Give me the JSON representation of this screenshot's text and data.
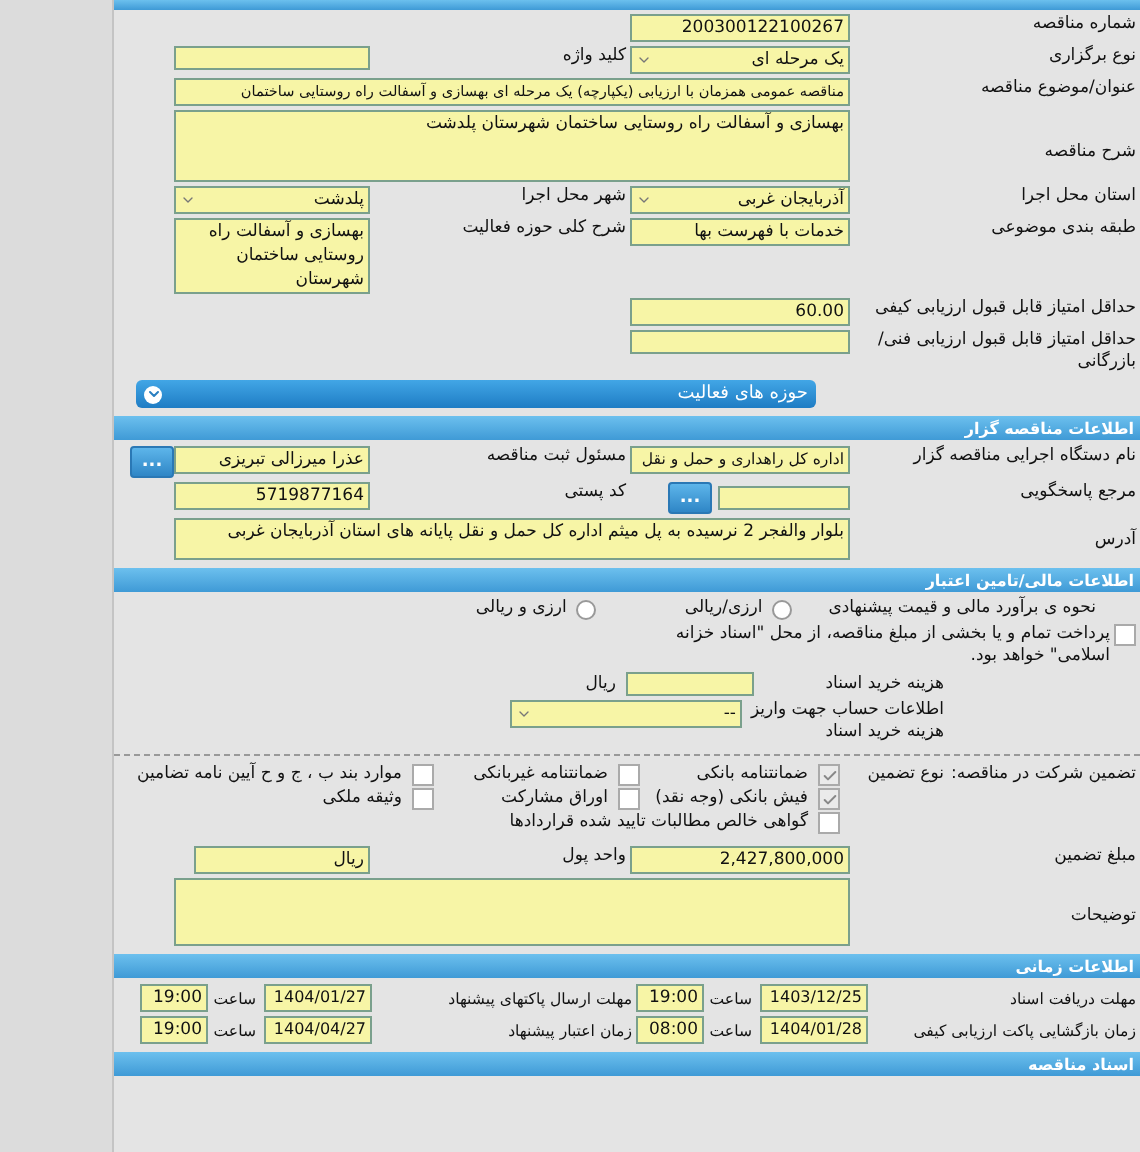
{
  "tender": {
    "number": {
      "label": "شماره مناقصه",
      "value": "200300122100267"
    },
    "holding_type": {
      "label": "نوع برگزاری",
      "value": "یک مرحله ای"
    },
    "keyword": {
      "label": "کلید واژه"
    },
    "title": {
      "label": "عنوان/موضوع مناقصه",
      "value": "مناقصه عمومی همزمان با ارزیابی (یکپارچه) یک مرحله ای بهسازی و آسفالت راه روستایی ساختمان"
    },
    "description": {
      "label": "شرح مناقصه",
      "value": "بهسازی و آسفالت راه روستایی ساختمان شهرستان پلدشت"
    },
    "province": {
      "label": "استان محل اجرا",
      "value": "آذربایجان غربی"
    },
    "city": {
      "label": "شهر محل اجرا",
      "value": "پلدشت"
    },
    "classification": {
      "label": "طبقه بندی موضوعی",
      "value": "خدمات با فهرست بها"
    },
    "activity_scope": {
      "label": "شرح کلی حوزه فعالیت",
      "value": "بهسازی و آسفالت راه روستایی ساختمان شهرستان"
    },
    "min_quality_score": {
      "label": "حداقل امتیاز قابل قبول ارزیابی کیفی",
      "value": "60.00"
    },
    "min_technical_score": {
      "label": "حداقل امتیاز قابل قبول ارزیابی فنی/بازرگانی"
    },
    "activity_fields": {
      "title": "حوزه های فعالیت",
      "expanded": false
    }
  },
  "organizer": {
    "title": "اطلاعات مناقصه گزار",
    "agency": {
      "label": "نام دستگاه اجرایی مناقصه گزار",
      "value": "اداره کل راهداری و حمل و نقل"
    },
    "registrar": {
      "label": "مسئول ثبت مناقصه",
      "value": "عذرا میرزالی تبریزی",
      "button": "..."
    },
    "response_ref": {
      "label": "مرجع پاسخگویی",
      "button": "..."
    },
    "postal_code": {
      "label": "کد پستی",
      "value": "5719877164"
    },
    "address": {
      "label": "آدرس",
      "value": "بلوار والفجر 2 نرسیده به پل میثم اداره کل حمل و نقل پایانه های استان آذربایجان غربی"
    }
  },
  "finance": {
    "title": "اطلاعات مالی/تامین اعتبار",
    "estimate": {
      "label": "نحوه ی برآورد مالی و قیمت پیشنهادی",
      "options": [
        {
          "label": "ارزی/ریالی",
          "selected": false
        },
        {
          "label": "ارزی و ریالی",
          "selected": false
        }
      ]
    },
    "treasury": {
      "label": "پرداخت تمام و یا بخشی از مبلغ مناقصه، از محل \"اسناد خزانه اسلامی\" خواهد بود.",
      "checked": false
    },
    "doc_fee": {
      "label": "هزینه خرید اسناد",
      "unit": "ریال"
    },
    "account": {
      "label": "اطلاعات حساب جهت واریز هزینه خرید اسناد",
      "value": "--"
    }
  },
  "guarantee": {
    "label": "تضمین شرکت در مناقصه:",
    "type_label": "نوع تضمین",
    "options": [
      {
        "label": "ضمانتنامه بانکی",
        "checked": true
      },
      {
        "label": "ضمانتنامه غیربانکی",
        "checked": false
      },
      {
        "label": "موارد بند ب ، ج و ح آیین نامه تضامین",
        "checked": false
      },
      {
        "label": "فیش بانکی (وجه نقد)",
        "checked": true
      },
      {
        "label": "اوراق مشارکت",
        "checked": false
      },
      {
        "label": "وثیقه ملکی",
        "checked": false
      },
      {
        "label": "گواهی خالص مطالبات تایید شده قراردادها",
        "checked": false
      }
    ],
    "amount": {
      "label": "مبلغ تضمین",
      "value": "2,427,800,000"
    },
    "currency": {
      "label": "واحد پول",
      "value": "ریال"
    },
    "notes": {
      "label": "توضیحات"
    }
  },
  "timing": {
    "title": "اطلاعات زمانی",
    "items": [
      {
        "label": "مهلت دریافت اسناد",
        "date": "1403/12/25",
        "time_label": "ساعت",
        "time": "19:00"
      },
      {
        "label": "مهلت ارسال پاکتهای پیشنهاد",
        "date": "1404/01/27",
        "time_label": "ساعت",
        "time": "19:00"
      },
      {
        "label": "زمان بازگشایی پاکت ارزیابی کیفی",
        "date": "1404/01/28",
        "time_label": "ساعت",
        "time": "08:00"
      },
      {
        "label": "زمان اعتبار پیشنهاد",
        "date": "1404/04/27",
        "time_label": "ساعت",
        "time": "19:00"
      }
    ]
  },
  "documents": {
    "title": "اسناد مناقصه"
  }
}
